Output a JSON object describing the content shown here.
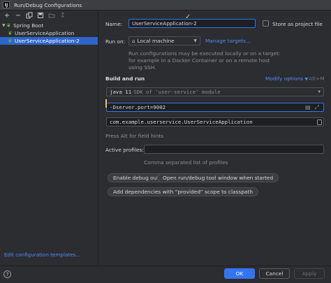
{
  "window": {
    "title": "Run/Debug Configurations",
    "app_icon_text": "IJ"
  },
  "toolbar": {
    "icons": [
      "add-icon",
      "remove-icon",
      "copy-icon",
      "save-icon",
      "folder-icon",
      "sort-icon"
    ]
  },
  "tree": {
    "group_label": "Spring Boot",
    "items": [
      {
        "label": "UserServiceApplication"
      },
      {
        "label": "UserServiceApplication-2"
      }
    ]
  },
  "sidebar_footer": {
    "edit_templates": "Edit configuration templates..."
  },
  "form": {
    "name_label": "Name:",
    "name_value": "UserServiceApplication-2",
    "store_project_label": "Store as project file",
    "run_on_label": "Run on:",
    "run_on_value": "Local machine",
    "manage_targets": "Manage targets...",
    "run_on_description": "Run configurations may be executed locally or on a target: for example in a Docker Container or on a remote host using SSH."
  },
  "build_run": {
    "title": "Build and run",
    "modify_options": "Modify options",
    "modify_shortcut": "Alt+M",
    "jdk_version": "java 11",
    "jdk_desc": "SDK of 'user-service' module",
    "vm_options": "-Dserver.port=9002",
    "main_class": "com.example.userservice.UserServiceApplication",
    "field_hint": "Press Alt for field hints",
    "profiles_label": "Active profiles:",
    "profiles_value": "",
    "profiles_hint": "Comma separated list of profiles"
  },
  "chips": {
    "debug_output": "Enable debug output",
    "tool_window": "Open run/debug tool window when started",
    "provided_scope": "Add dependencies with “provided” scope to classpath"
  },
  "buttons": {
    "ok": "OK",
    "cancel": "Cancel",
    "apply": "Apply"
  },
  "colors": {
    "accent": "#3574f0",
    "link": "#548af7",
    "spring": "#62b543",
    "caret": "#e3c94b"
  }
}
